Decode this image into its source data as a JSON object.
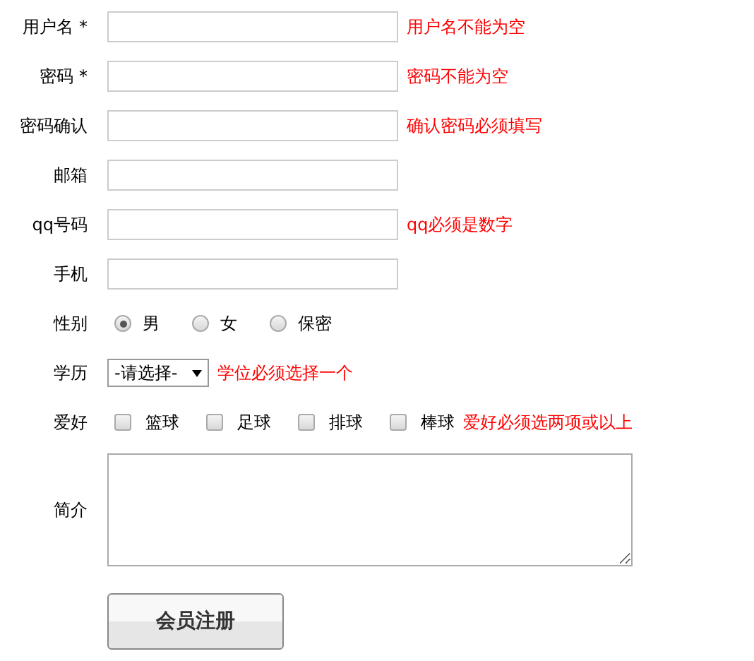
{
  "fields": [
    {
      "kind": "text",
      "label": "用户名 *",
      "error": "用户名不能为空"
    },
    {
      "kind": "text",
      "label": "密码 *",
      "error": "密码不能为空"
    },
    {
      "kind": "text",
      "label": "密码确认",
      "error": "确认密码必须填写"
    },
    {
      "kind": "text",
      "label": "邮箱"
    },
    {
      "kind": "text",
      "label": "qq号码",
      "error": "qq必须是数字"
    },
    {
      "kind": "text",
      "label": "手机"
    },
    {
      "kind": "radio",
      "label": "性别",
      "options": [
        {
          "label": "男",
          "selected": true
        },
        {
          "label": "女",
          "selected": false
        },
        {
          "label": "保密",
          "selected": false
        }
      ]
    },
    {
      "kind": "select",
      "label": "学历",
      "value": "-请选择-",
      "error": "学位必须选择一个"
    },
    {
      "kind": "checkbox",
      "label": "爱好",
      "options": [
        {
          "label": "篮球",
          "checked": false
        },
        {
          "label": "足球",
          "checked": false
        },
        {
          "label": "排球",
          "checked": false
        },
        {
          "label": "棒球",
          "checked": false
        }
      ],
      "error": "爱好必须选两项或以上"
    },
    {
      "kind": "textarea",
      "label": "简介"
    }
  ],
  "submit": "会员注册"
}
